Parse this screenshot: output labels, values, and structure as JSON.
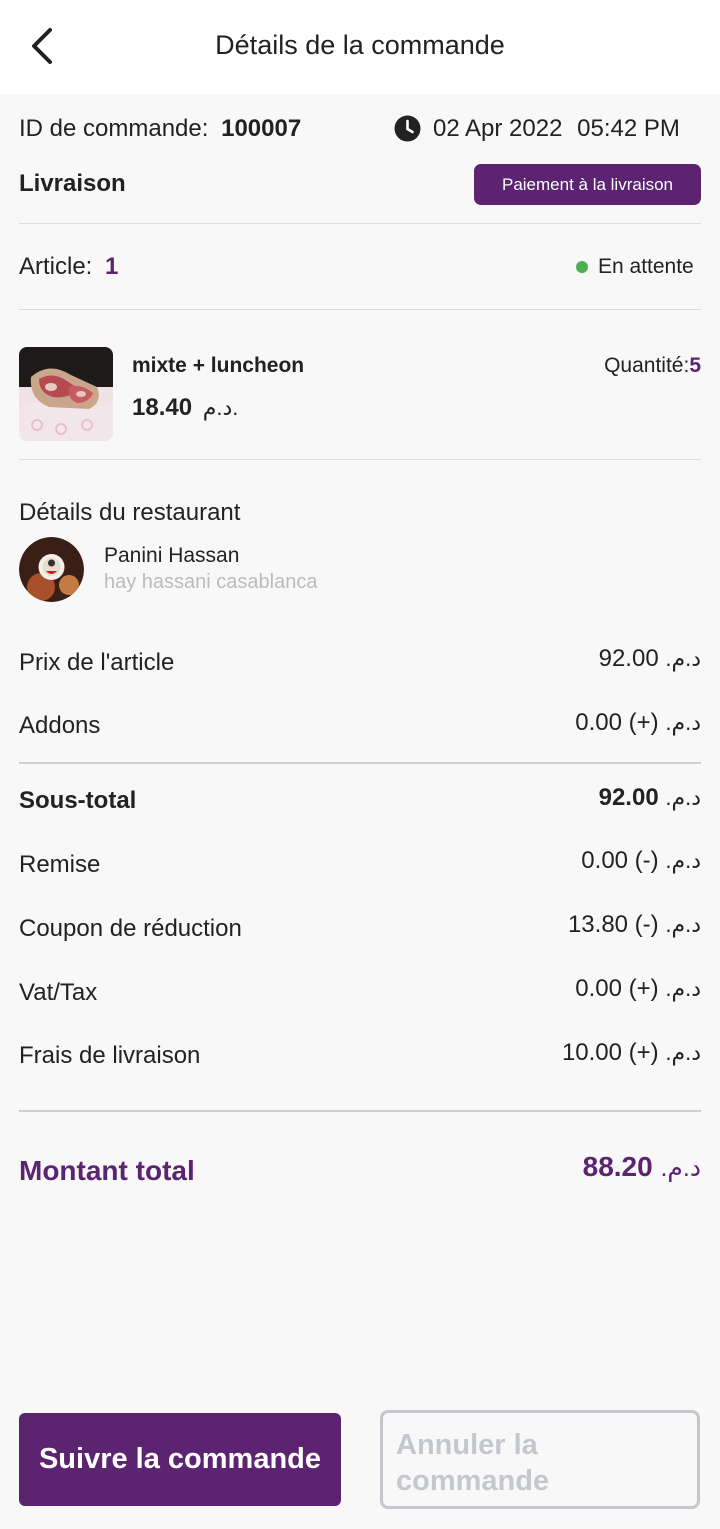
{
  "header": {
    "title": "Détails de la commande"
  },
  "order": {
    "id_label": "ID de commande:",
    "id_value": "100007",
    "date": "02 Apr 2022",
    "time": "05:42 PM",
    "type": "Livraison",
    "payment_badge": "Paiement à la livraison",
    "article_label": "Article:",
    "article_count": "1",
    "status": "En attente",
    "status_color": "#4caf50"
  },
  "item": {
    "name": "mixte + luncheon",
    "price": "18.40",
    "currency": "د.م.",
    "quantity_label": "Quantité:",
    "quantity": "5"
  },
  "restaurant": {
    "section_title": "Détails du restaurant",
    "name": "Panini Hassan",
    "address": "hay hassani casablanca"
  },
  "summary": {
    "currency": "د.م.",
    "item_price_label": "Prix de l'article",
    "item_price_value": "92.00",
    "addons_label": "Addons",
    "addons_value": "(+) 0.00",
    "subtotal_label": "Sous-total",
    "subtotal_value": "92.00",
    "discount_label": "Remise",
    "discount_value": "(-) 0.00",
    "coupon_label": "Coupon de réduction",
    "coupon_value": "(-) 13.80",
    "vat_label": "Vat/Tax",
    "vat_value": "(+) 0.00",
    "delivery_label": "Frais de livraison",
    "delivery_value": "(+) 10.00",
    "total_label": "Montant total",
    "total_value": "88.20"
  },
  "actions": {
    "track_label": "Suivre la commande",
    "cancel_label": "Annuler la commande"
  },
  "colors": {
    "accent": "#5c2371",
    "disabled": "#c4c8cc"
  },
  "icons": {
    "back": "chevron-left-icon",
    "clock": "clock-icon"
  }
}
